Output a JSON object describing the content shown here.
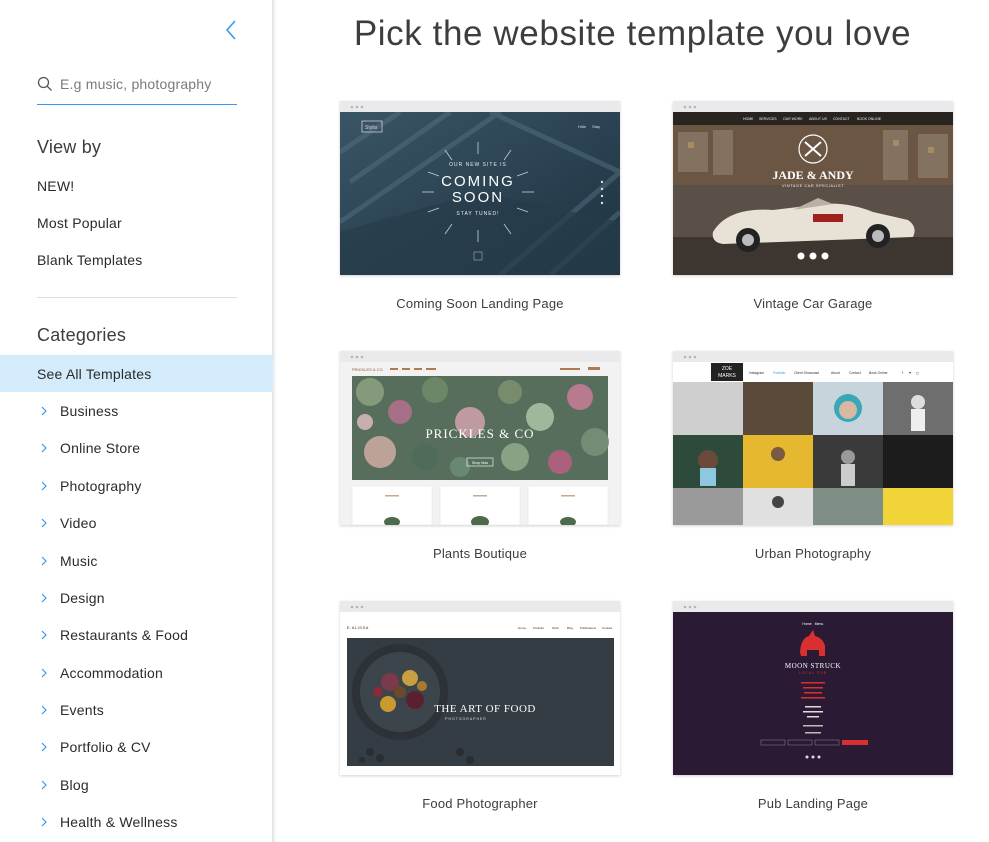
{
  "sidebar": {
    "search": {
      "placeholder": "E.g music, photography",
      "value": ""
    },
    "view_by": {
      "title": "View by",
      "items": [
        "NEW!",
        "Most Popular",
        "Blank Templates"
      ]
    },
    "categories": {
      "title": "Categories",
      "selected": "See All Templates",
      "items": [
        "Business",
        "Online Store",
        "Photography",
        "Video",
        "Music",
        "Design",
        "Restaurants & Food",
        "Accommodation",
        "Events",
        "Portfolio & CV",
        "Blog",
        "Health & Wellness"
      ]
    }
  },
  "main": {
    "title": "Pick the website template you love",
    "templates": [
      {
        "name": "Coming Soon Landing Page",
        "thumb": {
          "brand": "Stylio",
          "kicker": "OUR NEW SITE IS",
          "headline1": "COMING",
          "headline2": "SOON",
          "tagline": "STAY TUNED!",
          "nav1": "Hide",
          "nav2": "Stay"
        }
      },
      {
        "name": "Vintage Car Garage",
        "thumb": {
          "nav": [
            "HOME",
            "SERVICES",
            "OUR WORK",
            "ABOUT US",
            "CONTACT",
            "BOOK ONLINE"
          ],
          "headline": "JADE & ANDY",
          "tagline": "VINTAGE CAR SPECIALIST"
        }
      },
      {
        "name": "Plants Boutique",
        "thumb": {
          "brand": "PRICKLES & CO",
          "headline": "PRICKLES & CO",
          "cta": "Shop Now"
        }
      },
      {
        "name": "Urban Photography",
        "thumb": {
          "brand1": "ZOE",
          "brand2": "MARKS",
          "nav": [
            "Instagram",
            "Portfolio",
            "Client Showcase",
            "About",
            "Contact",
            "Book Online"
          ]
        }
      },
      {
        "name": "Food Photographer",
        "thumb": {
          "brand": "E.ALISSA",
          "nav": [
            "Home",
            "Portfolio",
            "Work",
            "Blog",
            "Publications",
            "Contact"
          ],
          "headline": "THE ART OF FOOD",
          "tagline": "PHOTOGRAPHER"
        }
      },
      {
        "name": "Pub Landing Page",
        "thumb": {
          "nav1": "Home",
          "nav2": "Menu",
          "headline": "MOON STRUCK",
          "tagline": "LOCAL PUB"
        }
      }
    ]
  },
  "colors": {
    "accent": "#3899ec",
    "selected_bg": "#d4ebfb"
  }
}
